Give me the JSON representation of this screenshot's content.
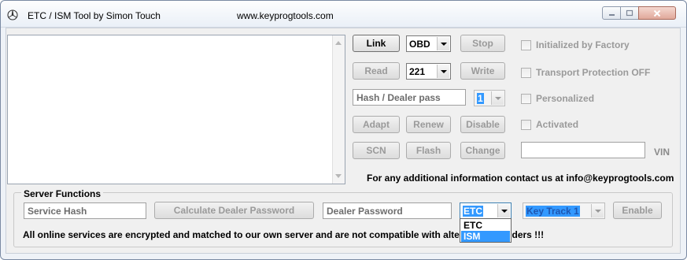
{
  "window": {
    "title": "ETC / ISM Tool by Simon Touch",
    "url": "www.keyprogtools.com"
  },
  "controls": {
    "link": "Link",
    "read": "Read",
    "stop": "Stop",
    "write": "Write",
    "adapt": "Adapt",
    "renew": "Renew",
    "disable": "Disable",
    "scn": "SCN",
    "flash": "Flash",
    "change": "Change",
    "interface_combo": "OBD",
    "model_combo": "221",
    "hash_placeholder": "Hash / Dealer pass",
    "small_combo": "1"
  },
  "status": {
    "initialized": "Initialized by Factory",
    "transport": "Transport Protection OFF",
    "personalized": "Personalized",
    "activated": "Activated",
    "vin_label": "VIN"
  },
  "contact": "For any additional information contact us at info@keyprogtools.com",
  "server": {
    "title": "Server Functions",
    "service_hash_placeholder": "Service Hash",
    "calc_button": "Calculate Dealer Password",
    "dealer_password_placeholder": "Dealer Password",
    "type_combo": "ETC",
    "type_options": [
      "ETC",
      "ISM"
    ],
    "key_track": "Key Track 1",
    "enable_button": "Enable",
    "notice": "All online services are encrypted and matched to our own server and are not compatible with alter",
    "notice_tail": "ders !!!"
  }
}
